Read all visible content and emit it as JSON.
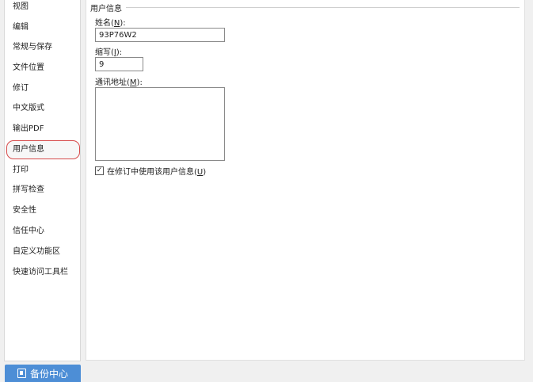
{
  "sidebar": {
    "items": [
      {
        "label": "视图"
      },
      {
        "label": "编辑"
      },
      {
        "label": "常规与保存"
      },
      {
        "label": "文件位置"
      },
      {
        "label": "修订"
      },
      {
        "label": "中文版式"
      },
      {
        "label": "输出PDF"
      },
      {
        "label": "用户信息",
        "selected": true
      },
      {
        "label": "打印"
      },
      {
        "label": "拼写检查"
      },
      {
        "label": "安全性"
      },
      {
        "label": "信任中心"
      },
      {
        "label": "自定义功能区"
      },
      {
        "label": "快速访问工具栏"
      }
    ],
    "backup_label": "备份中心",
    "backup_icon": "backup-icon"
  },
  "main": {
    "section_title": "用户信息",
    "name_label_pre": "姓名(",
    "name_label_key": "N",
    "name_label_post": "):",
    "name_value": "93P76W2",
    "initials_label_pre": "缩写(",
    "initials_label_key": "I",
    "initials_label_post": "):",
    "initials_value": "9",
    "address_label_pre": "通讯地址(",
    "address_label_key": "M",
    "address_label_post": "):",
    "address_value": "",
    "checkbox_label_pre": "在修订中使用该用户信息(",
    "checkbox_label_key": "U",
    "checkbox_label_post": ")",
    "checkbox_checked": true,
    "checkbox_mark": "✓"
  },
  "colors": {
    "selected_border": "#d64a4a",
    "backup_button": "#4d8ed6"
  }
}
